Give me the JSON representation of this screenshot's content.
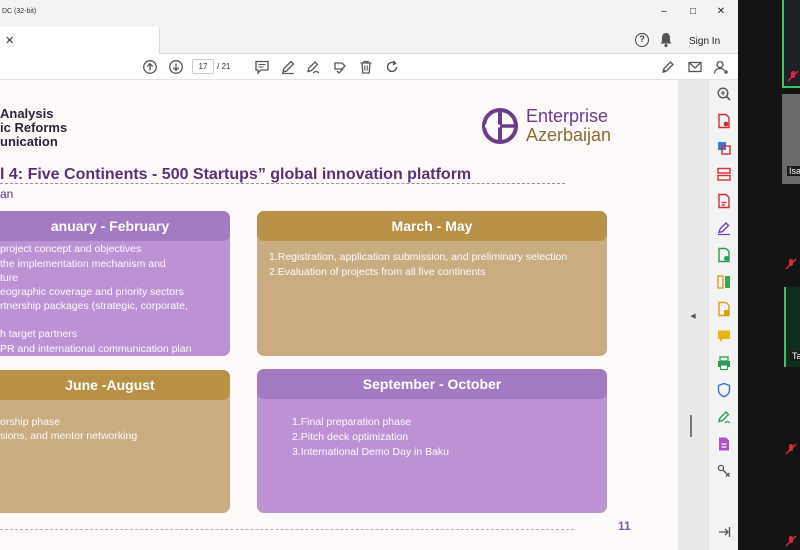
{
  "window": {
    "title": "DC (32-bit)",
    "controls": [
      "–",
      "□",
      "✕"
    ]
  },
  "tab": {
    "close": "✕"
  },
  "top_actions": {
    "help": "?",
    "sign_in": "Sign In"
  },
  "toolbar": {
    "page_current": "17",
    "page_total": "/ 21"
  },
  "document": {
    "heading_lines": [
      "Analysis",
      "ic Reforms",
      "unication"
    ],
    "logo_line1": "Enterprise",
    "logo_line2": "Azerbaijan",
    "title": "l 4: Five Continents - 500 Startups” global innovation platform",
    "subtitle": "an",
    "page_number": "11",
    "cards": [
      {
        "header": "anuary - February",
        "lines": [
          "project concept and objectives",
          "  the   implementation   mechanism   and",
          "ture",
          "eographic coverage and priority sectors",
          "rtnership packages (strategic, corporate,",
          "",
          "h target partners",
          "PR and international communication plan"
        ]
      },
      {
        "header": "March - May",
        "lines": [
          "1.Registration, application submission, and preliminary selection",
          "2.Evaluation of projects from all five continents"
        ]
      },
      {
        "header": " June -August",
        "lines": [
          "orship phase",
          "sions, and mentor networking"
        ]
      },
      {
        "header": "September - October",
        "lines": [
          "1.Final preparation phase",
          "2.Pitch deck optimization",
          "3.International Demo Day in Baku"
        ]
      }
    ]
  },
  "video_panel": {
    "tiles": [
      {
        "label": "Isa"
      },
      {
        "label": "Ta"
      }
    ]
  },
  "colors": {
    "purple_header": "#a37bc2",
    "purple_body": "#bc92d4",
    "gold_header": "#b89147",
    "gold_body": "#c9ad81",
    "accent_red": "#d42b3a"
  }
}
